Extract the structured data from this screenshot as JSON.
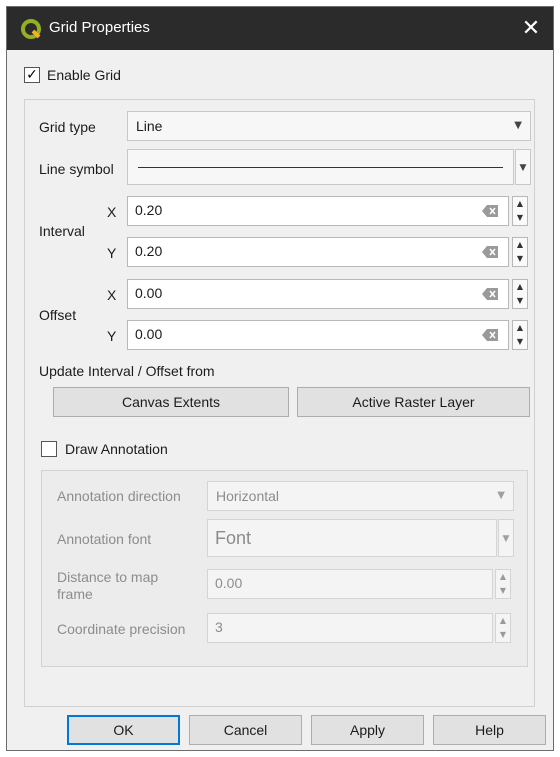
{
  "window": {
    "title": "Grid Properties",
    "app_icon": "qgis-logo-icon",
    "close_glyph": "✕"
  },
  "enable_grid": {
    "label": "Enable Grid",
    "checked": true,
    "check_glyph": "✓"
  },
  "grid": {
    "grid_type_label": "Grid type",
    "grid_type_value": "Line",
    "line_symbol_label": "Line symbol",
    "interval_label": "Interval",
    "offset_label": "Offset",
    "x_label": "X",
    "y_label": "Y",
    "interval_x": "0.20",
    "interval_y": "0.20",
    "offset_x": "0.00",
    "offset_y": "0.00",
    "update_label": "Update Interval / Offset from",
    "canvas_extents_button": "Canvas Extents",
    "active_raster_button": "Active Raster Layer"
  },
  "annotation": {
    "label": "Draw Annotation",
    "checked": false,
    "direction_label": "Annotation direction",
    "direction_value": "Horizontal",
    "font_label": "Annotation font",
    "font_value": "Font",
    "distance_label_line1": "Distance to map",
    "distance_label_line2": "frame",
    "distance_value": "0.00",
    "precision_label": "Coordinate precision",
    "precision_value": "3"
  },
  "footer": {
    "ok": "OK",
    "cancel": "Cancel",
    "apply": "Apply",
    "help": "Help"
  }
}
